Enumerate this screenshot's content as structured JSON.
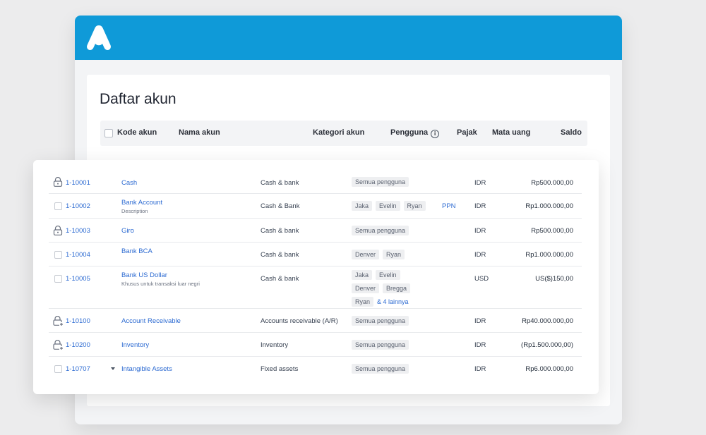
{
  "app": {
    "logo": "a-logo",
    "accent_color": "#0f9ad8"
  },
  "page": {
    "title": "Daftar akun"
  },
  "table": {
    "headers": {
      "code": "Kode akun",
      "name": "Nama akun",
      "category": "Kategori akun",
      "users": "Pengguna",
      "tax": "Pajak",
      "currency": "Mata uang",
      "balance": "Saldo"
    },
    "rows": [
      {
        "icon": "lock-icon",
        "code": "1-10001",
        "name": "Cash",
        "desc": "",
        "category": "Cash & bank",
        "users": [
          "Semua pengguna"
        ],
        "more": "",
        "tax": "",
        "currency": "IDR",
        "balance": "Rp500.000,00"
      },
      {
        "icon": "checkbox",
        "code": "1-10002",
        "name": "Bank Account",
        "desc": "Description",
        "category": "Cash & Bank",
        "users": [
          "Jaka",
          "Evelin",
          "Ryan"
        ],
        "more": "",
        "tax": "PPN",
        "currency": "IDR",
        "balance": "Rp1.000.000,00"
      },
      {
        "icon": "lock-icon",
        "code": "1-10003",
        "name": "Giro",
        "desc": "",
        "category": "Cash & bank",
        "users": [
          "Semua pengguna"
        ],
        "more": "",
        "tax": "",
        "currency": "IDR",
        "balance": "Rp500.000,00"
      },
      {
        "icon": "checkbox",
        "code": "1-10004",
        "name": "Bank BCA",
        "desc": "",
        "category": "Cash & bank",
        "users": [
          "Denver",
          "Ryan"
        ],
        "more": "",
        "tax": "",
        "currency": "IDR",
        "balance": "Rp1.000.000,00"
      },
      {
        "icon": "checkbox",
        "code": "1-10005",
        "name": "Bank US Dollar",
        "desc": "Khusus untuk transaksi luar negri",
        "category": "Cash & bank",
        "users": [
          "Jaka",
          "Evelin",
          "Denver",
          "Bregga",
          "Ryan"
        ],
        "more": "& 4 lainnya",
        "tax": "",
        "currency": "USD",
        "balance": "US($)150,00"
      },
      {
        "icon": "lock-plus-icon",
        "code": "1-10100",
        "name": "Account Receivable",
        "desc": "",
        "category": "Accounts receivable (A/R)",
        "users": [
          "Semua pengguna"
        ],
        "more": "",
        "tax": "",
        "currency": "IDR",
        "balance": "Rp40.000.000,00"
      },
      {
        "icon": "lock-plus-icon",
        "code": "1-10200",
        "name": "Inventory",
        "desc": "",
        "category": "Inventory",
        "users": [
          "Semua pengguna"
        ],
        "more": "",
        "tax": "",
        "currency": "IDR",
        "balance": "(Rp1.500.000,00)"
      },
      {
        "icon": "checkbox",
        "code": "1-10707",
        "name": "Intangible Assets",
        "desc": "",
        "category": "Fixed assets",
        "users": [
          "Semua pengguna"
        ],
        "more": "",
        "tax": "",
        "currency": "IDR",
        "balance": "Rp6.000.000,00",
        "expandable": true
      }
    ]
  }
}
